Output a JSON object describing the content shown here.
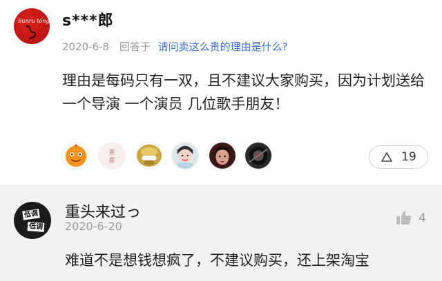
{
  "answer": {
    "username": "s***郎",
    "date": "2020-6-8",
    "reply_to_label": "回答于",
    "question": "请问卖这么贵的理由是什么?",
    "text": "理由是每码只有一双，且不建议大家购买，因为计划送给一个导演 一个演员 几位歌手朋友！",
    "avatar_logo_text": "Sunru  tóngi",
    "upvote_count": "19",
    "liker_avatars": [
      "orange-cartoon",
      "tea-house-logo",
      "gold-monkey",
      "girl-photo",
      "dark-portrait",
      "car-wheel"
    ],
    "liker_tea_text": "茶\n居"
  },
  "comment": {
    "username": "重头来过っ",
    "date": "2020-6-20",
    "like_count": "4",
    "text": "难道不是想钱想疯了，不建议购买，还上架淘宝",
    "avatar_tag_1": "低调",
    "avatar_tag_2": "低调"
  },
  "colors": {
    "link_blue": "#3a6fd0",
    "meta_gray": "#999999",
    "comment_bg": "#f2f2f2",
    "brand_red": "#c8161b"
  }
}
